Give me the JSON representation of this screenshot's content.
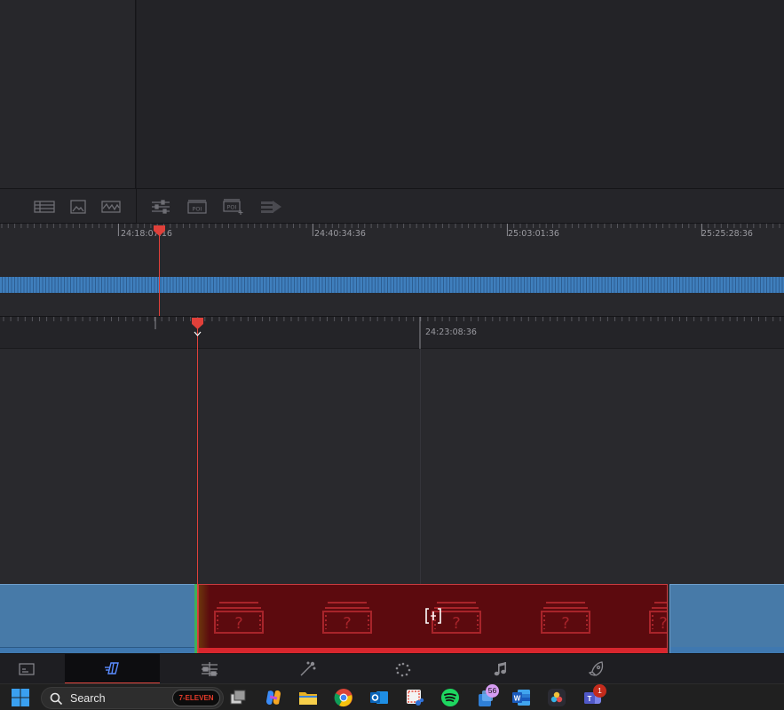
{
  "upper_ruler": {
    "timecodes": [
      "24:18:07:16",
      "24:40:34:36",
      "25:03:01:36",
      "25:25:28:36"
    ]
  },
  "lower_ruler": {
    "timecodes": [
      "24:23:08:36"
    ]
  },
  "taskbar": {
    "search_label": "Search",
    "search_badge": "7-ELEVEN",
    "teams_notifications": "56",
    "teams2_notifications": "1"
  },
  "colors": {
    "accent_red": "#e2483f",
    "clip_blue": "#477aa8",
    "offline_clip": "#5c0a0e",
    "audio_band_red": "#d8262e",
    "playhead": "#e0403a"
  },
  "icons": {
    "toolbar": [
      "clip-list-icon",
      "image-icon",
      "waveform-icon",
      "sliders-icon",
      "poi-icon",
      "poi-add-icon",
      "play-track-icon"
    ],
    "pages": [
      "media-page-icon",
      "cut-page-icon",
      "edit-page-icon",
      "fusion-page-icon",
      "color-page-icon",
      "fairlight-page-icon",
      "deliver-page-icon"
    ]
  }
}
